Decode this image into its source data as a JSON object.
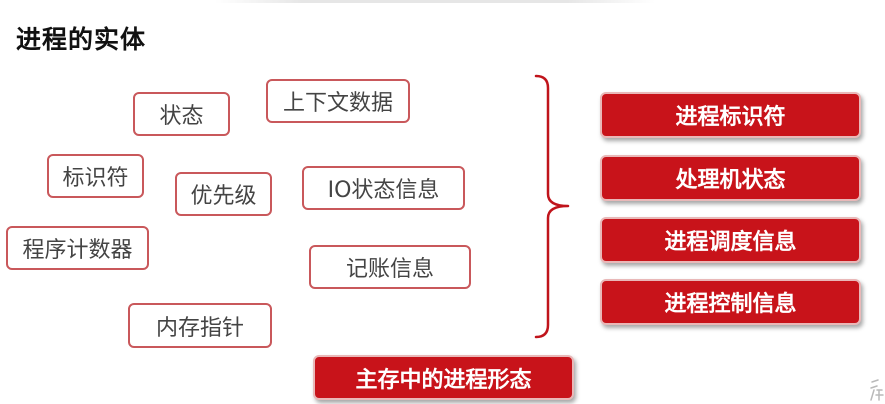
{
  "title": "进程的实体",
  "components": [
    "状态",
    "上下文数据",
    "标识符",
    "优先级",
    "IO状态信息",
    "程序计数器",
    "记账信息",
    "内存指针"
  ],
  "categories": [
    "进程标识符",
    "处理机状态",
    "进程调度信息",
    "进程控制信息"
  ],
  "caption": "主存中的进程形态",
  "colors": {
    "accent": "#c8131a",
    "tag_border": "#c9585b",
    "brace": "#c0141b"
  }
}
